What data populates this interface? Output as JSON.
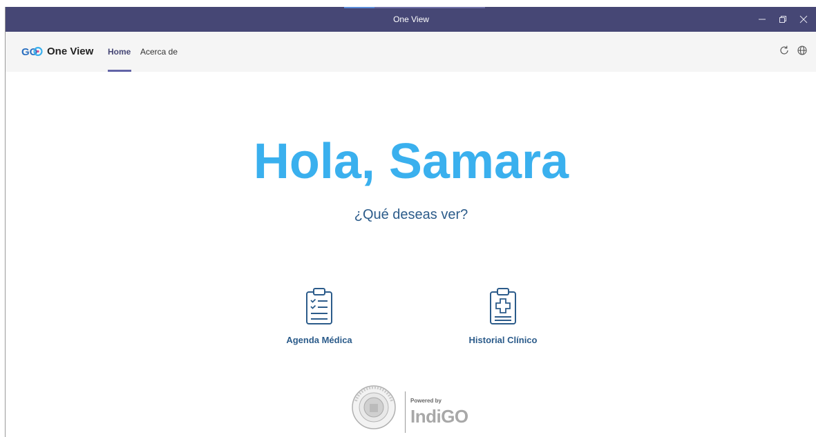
{
  "window": {
    "title": "One View"
  },
  "navbar": {
    "logo_text": "GO",
    "app_name": "One View",
    "links": [
      {
        "label": "Home"
      },
      {
        "label": "Acerca de"
      }
    ]
  },
  "main": {
    "greeting": "Hola, Samara",
    "question": "¿Qué deseas ver?",
    "options": [
      {
        "label": "Agenda Médica",
        "icon": "clipboard-checklist-icon"
      },
      {
        "label": "Historial Clínico",
        "icon": "clipboard-medical-icon"
      }
    ]
  },
  "footer": {
    "powered_by": "Powered by",
    "brand": "IndiGO",
    "seal_text": "INSTITUTO DE PREVISION SOCIAL PARAGUAY"
  },
  "colors": {
    "titlebar": "#464775",
    "accent": "#6264a7",
    "greeting": "#3ab0ee",
    "text_primary": "#2b5b8a"
  }
}
